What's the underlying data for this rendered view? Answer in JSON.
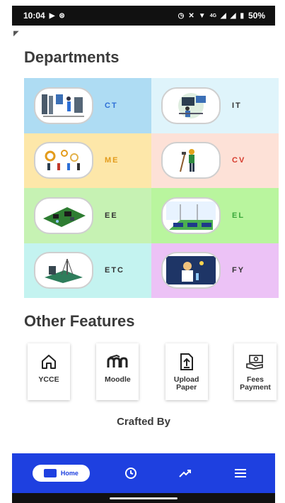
{
  "status": {
    "time": "10:04",
    "network": "4G",
    "battery": "50%"
  },
  "departments": {
    "title": "Departments",
    "items": [
      {
        "code": "CT",
        "bg": "#aedcf3",
        "color": "#2d6fd6"
      },
      {
        "code": "IT",
        "bg": "#dff4fb",
        "color": "#333333"
      },
      {
        "code": "ME",
        "bg": "#fde7a9",
        "color": "#e39b1b"
      },
      {
        "code": "CV",
        "bg": "#fde1d7",
        "color": "#d63a2c"
      },
      {
        "code": "EE",
        "bg": "#c6f2b3",
        "color": "#333333"
      },
      {
        "code": "EL",
        "bg": "#b9f59e",
        "color": "#3ba83b"
      },
      {
        "code": "ETC",
        "bg": "#c4f3f0",
        "color": "#333333"
      },
      {
        "code": "FY",
        "bg": "#ecc2f6",
        "color": "#333333"
      }
    ]
  },
  "other_features": {
    "title": "Other Features",
    "items": [
      {
        "label": "YCCE",
        "icon": "house-icon"
      },
      {
        "label": "Moodle",
        "icon": "moodle-icon"
      },
      {
        "label": "Upload Paper",
        "icon": "upload-icon"
      },
      {
        "label": "Fees Payment",
        "icon": "money-icon"
      }
    ]
  },
  "crafted_by": "Crafted By",
  "navbar": {
    "home_label": "Home",
    "accent": "#1e40e0"
  }
}
